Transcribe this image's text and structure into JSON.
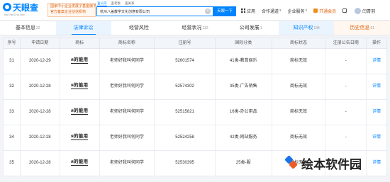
{
  "brand": {
    "logo_text": "天眼查",
    "logo_sub": "TianYanCha.com"
  },
  "promo": {
    "line1": "国家中小企业发展子基金旗下",
    "line2": "官方备案企业征信机构"
  },
  "search": {
    "tabs": [
      "查公司",
      "查老板",
      "查关系"
    ],
    "value": "杭州八盖教学文化创意有限公司",
    "button": "天眼一下"
  },
  "nav": {
    "items": [
      "应用",
      "合作通道",
      "企业服务",
      "开通会员"
    ],
    "user": "闫青羽"
  },
  "tabs": [
    {
      "label": "基本信息",
      "count": "22"
    },
    {
      "label": "法律诉讼",
      "count": ""
    },
    {
      "label": "经营风险",
      "count": ""
    },
    {
      "label": "经营状况",
      "count": "132"
    },
    {
      "label": "公司发展",
      "count": "1"
    },
    {
      "label": "知识产权",
      "count": "134"
    },
    {
      "label": "历史信息",
      "count": "61"
    }
  ],
  "table": {
    "headers": [
      "序号",
      "申请日期",
      "商标",
      "商标名称",
      "注册号",
      "国际分类",
      "商标状态",
      "注册公告日期",
      "操作"
    ],
    "rows": [
      {
        "no": "31",
        "date": "2020-12-29",
        "mark": "я的能用",
        "name": "老师好我叫何同学",
        "reg": "52601574",
        "class": "41类-教育娱乐",
        "status": "商标无效",
        "pub": "-",
        "op": "详情"
      },
      {
        "no": "32",
        "date": "2020-12-28",
        "mark": "я的能用",
        "name": "老师好我叫何同学",
        "reg": "52574302",
        "class": "35类-广告销售",
        "status": "商标无效",
        "pub": "-",
        "op": "详情"
      },
      {
        "no": "33",
        "date": "2020-12-28",
        "mark": "я的能用",
        "name": "老师好我叫何同学",
        "reg": "52515821",
        "class": "16类-办公用品",
        "status": "商标无效",
        "pub": "-",
        "op": "详情"
      },
      {
        "no": "34",
        "date": "2020-12-28",
        "mark": "я的能用",
        "name": "老师好我叫何同学",
        "reg": "52524258",
        "class": "42类-网站服务",
        "status": "商标无效",
        "pub": "-",
        "op": "详情"
      },
      {
        "no": "35",
        "date": "2020-12-28",
        "mark": "я的能用",
        "name": "老师好我叫何同学",
        "reg": "52530395",
        "class": "25类-服",
        "status": "商标无效",
        "pub": "-",
        "op": "详情"
      }
    ]
  },
  "watermark": "绘本软件园",
  "colors": {
    "accent": "#0084ff",
    "orange": "#e0620d"
  }
}
